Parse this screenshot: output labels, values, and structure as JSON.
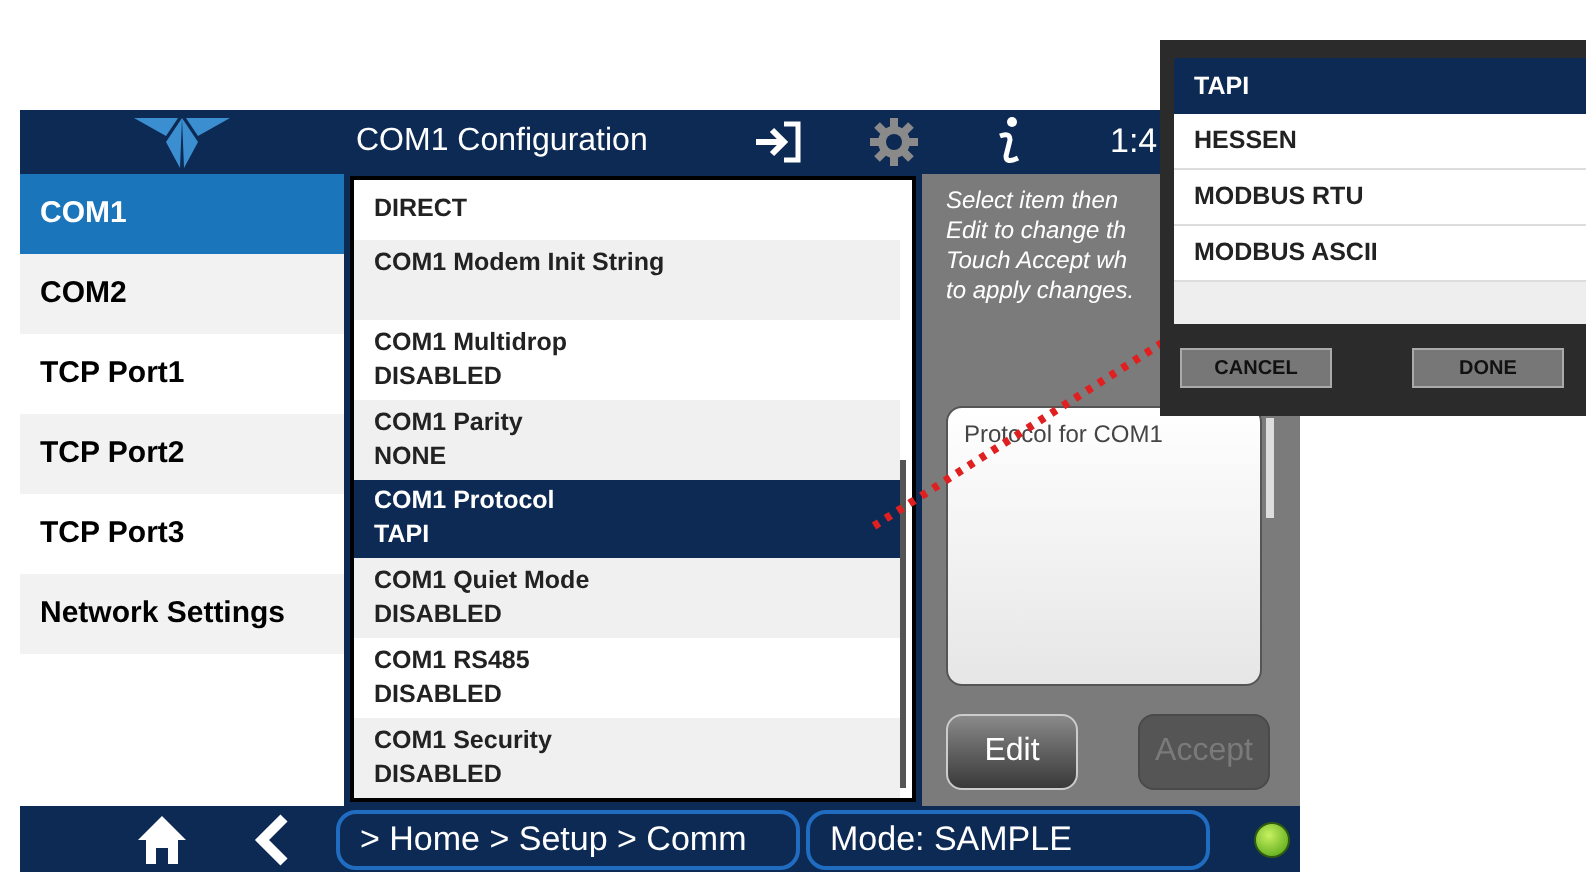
{
  "header": {
    "title": "COM1 Configuration",
    "time": "1:4"
  },
  "sidebar": {
    "items": [
      {
        "label": "COM1",
        "selected": true
      },
      {
        "label": "COM2",
        "selected": false
      },
      {
        "label": "TCP Port1",
        "selected": false
      },
      {
        "label": "TCP Port2",
        "selected": false
      },
      {
        "label": "TCP Port3",
        "selected": false
      },
      {
        "label": "Network Settings",
        "selected": false
      }
    ]
  },
  "settings": [
    {
      "value": "DIRECT",
      "selected": false
    },
    {
      "label": "COM1 Modem Init String",
      "selected": false
    },
    {
      "label": "COM1 Multidrop",
      "value": "DISABLED",
      "selected": false
    },
    {
      "label": "COM1 Parity",
      "value": "NONE",
      "selected": false
    },
    {
      "label": "COM1 Protocol",
      "value": "TAPI",
      "selected": true
    },
    {
      "label": "COM1 Quiet Mode",
      "value": "DISABLED",
      "selected": false
    },
    {
      "label": "COM1 RS485",
      "value": "DISABLED",
      "selected": false
    },
    {
      "label": "COM1 Security",
      "value": "DISABLED",
      "selected": false
    }
  ],
  "instructions": [
    "Select item then",
    "Edit to change th",
    "Touch Accept wh",
    "to apply changes."
  ],
  "description": "Protocol for COM1",
  "buttons": [
    {
      "label": "Edit",
      "disabled": false
    },
    {
      "label": "Accept",
      "disabled": true
    }
  ],
  "status_bar": {
    "breadcrumb": "> Home > Setup > Comm",
    "mode": "Mode: SAMPLE"
  },
  "popup": {
    "options": [
      {
        "label": "TAPI",
        "selected": true
      },
      {
        "label": "HESSEN",
        "selected": false
      },
      {
        "label": "MODBUS RTU",
        "selected": false
      },
      {
        "label": "MODBUS ASCII",
        "selected": false
      }
    ],
    "buttons": [
      "CANCEL",
      "DONE"
    ]
  }
}
